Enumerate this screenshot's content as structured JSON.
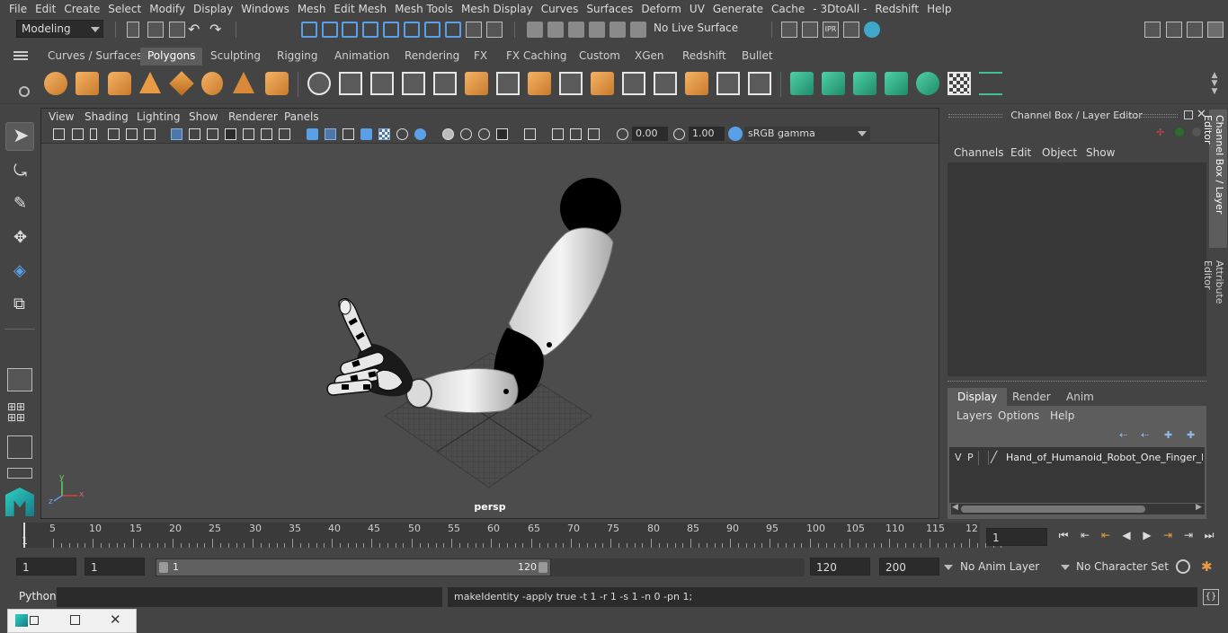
{
  "menubar": {
    "items": [
      "File",
      "Edit",
      "Create",
      "Select",
      "Modify",
      "Display",
      "Windows",
      "Mesh",
      "Edit Mesh",
      "Mesh Tools",
      "Mesh Display",
      "Curves",
      "Surfaces",
      "Deform",
      "UV",
      "Generate",
      "Cache",
      "- 3DtoAll -",
      "Redshift",
      "Help"
    ]
  },
  "statusline": {
    "mode": "Modeling",
    "live_surface": "No Live Surface"
  },
  "shelf": {
    "tabs": [
      "Curves / Surfaces",
      "Polygons",
      "Sculpting",
      "Rigging",
      "Animation",
      "Rendering",
      "FX",
      "FX Caching",
      "Custom",
      "XGen",
      "Redshift",
      "Bullet"
    ],
    "active_tab": "Polygons"
  },
  "viewport": {
    "menu": [
      "View",
      "Shading",
      "Lighting",
      "Show",
      "Renderer",
      "Panels"
    ],
    "exposure": "0.00",
    "gamma": "1.00",
    "color_space": "sRGB gamma",
    "camera": "persp",
    "axis": {
      "x": "x",
      "y": "y",
      "z": "z"
    }
  },
  "right_panel": {
    "title": "Channel Box / Layer Editor",
    "channel_menu": [
      "Channels",
      "Edit",
      "Object",
      "Show"
    ],
    "layer_tabs": [
      "Display",
      "Render",
      "Anim"
    ],
    "active_layer_tab": "Display",
    "layer_menu": [
      "Layers",
      "Options",
      "Help"
    ],
    "layer": {
      "v": "V",
      "p": "P",
      "name": "Hand_of_Humanoid_Robot_One_Finger_Po"
    },
    "side_tabs": [
      "Channel Box / Layer Editor",
      "Attribute Editor"
    ]
  },
  "timeline": {
    "start_label": "1",
    "ticks": [
      "5",
      "10",
      "15",
      "20",
      "25",
      "30",
      "35",
      "40",
      "45",
      "50",
      "55",
      "60",
      "65",
      "70",
      "75",
      "80",
      "85",
      "90",
      "95",
      "100",
      "105",
      "110",
      "115",
      "12"
    ],
    "current_frame": "1"
  },
  "range": {
    "start_field": "1",
    "start_field2": "1",
    "slider_start": "1",
    "slider_end": "120",
    "end_field": "120",
    "end_field2": "200",
    "anim_layer": "No Anim Layer",
    "character_set": "No Character Set"
  },
  "command": {
    "language": "Python",
    "result": "makeIdentity -apply true -t 1 -r 1 -s 1 -n 0 -pn 1;"
  },
  "colors": {
    "accent": "#5aa0e8",
    "shelf_orange": "#e99a45",
    "shelf_green": "#3fbf95"
  }
}
